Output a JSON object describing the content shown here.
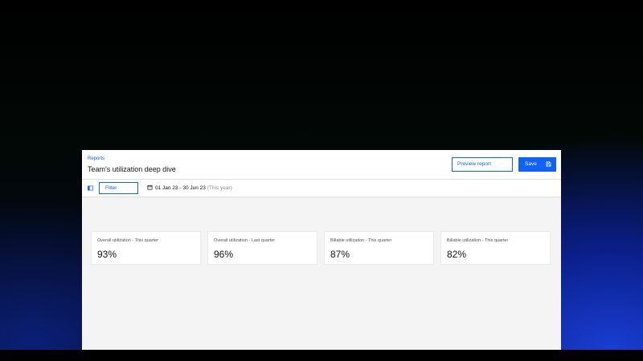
{
  "header": {
    "breadcrumb": "Reports",
    "title": "Team's utilization deep dive",
    "preview_label": "Preview report",
    "save_label": "Save"
  },
  "toolbar": {
    "filter_label": "Filter",
    "date_range": "01 Jan 23 - 30 Jun 23",
    "date_note": "(This year)"
  },
  "metrics": [
    {
      "label": "Overall utilization - This quarter",
      "value": "93%"
    },
    {
      "label": "Overall utilization - Last quarter",
      "value": "96%"
    },
    {
      "label": "Billable utilization - This quarter",
      "value": "87%"
    },
    {
      "label": "Billable utilization - This quarter",
      "value": "82%"
    }
  ],
  "colors": {
    "accent": "#0f62fe",
    "surface": "#ffffff",
    "canvas": "#f4f4f4",
    "text": "#161616"
  },
  "icons": {
    "save": "save-icon",
    "panel": "side-panel-icon",
    "calendar": "calendar-icon"
  }
}
